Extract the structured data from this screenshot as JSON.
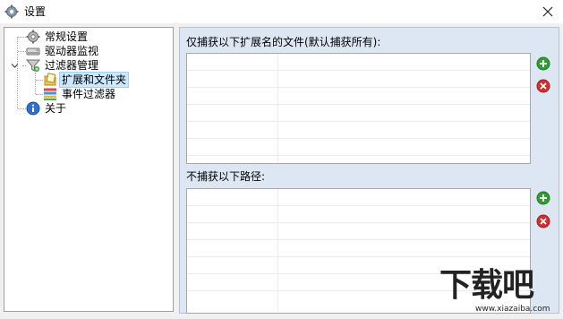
{
  "window": {
    "title": "设置"
  },
  "tree": {
    "items": [
      {
        "label": "常规设置",
        "icon": "gear-icon"
      },
      {
        "label": "驱动器监视",
        "icon": "drive-icon"
      },
      {
        "label": "过滤器管理",
        "icon": "filter-icon",
        "expanded": true
      },
      {
        "label": "扩展和文件夹",
        "icon": "folder-icon",
        "selected": true
      },
      {
        "label": "事件过滤器",
        "icon": "event-list-icon"
      },
      {
        "label": "关于",
        "icon": "info-icon"
      }
    ]
  },
  "panel": {
    "include_label": "仅捕获以下扩展名的文件(默认捕获所有):",
    "exclude_label": "不捕获以下路径:"
  },
  "colors": {
    "add": "#2e9e2e",
    "remove": "#d03030",
    "selection": "#cce8ff",
    "panel_bg": "#dde7f3"
  },
  "watermark": {
    "text": "下载吧",
    "url": "www.xiazaiba.com"
  }
}
